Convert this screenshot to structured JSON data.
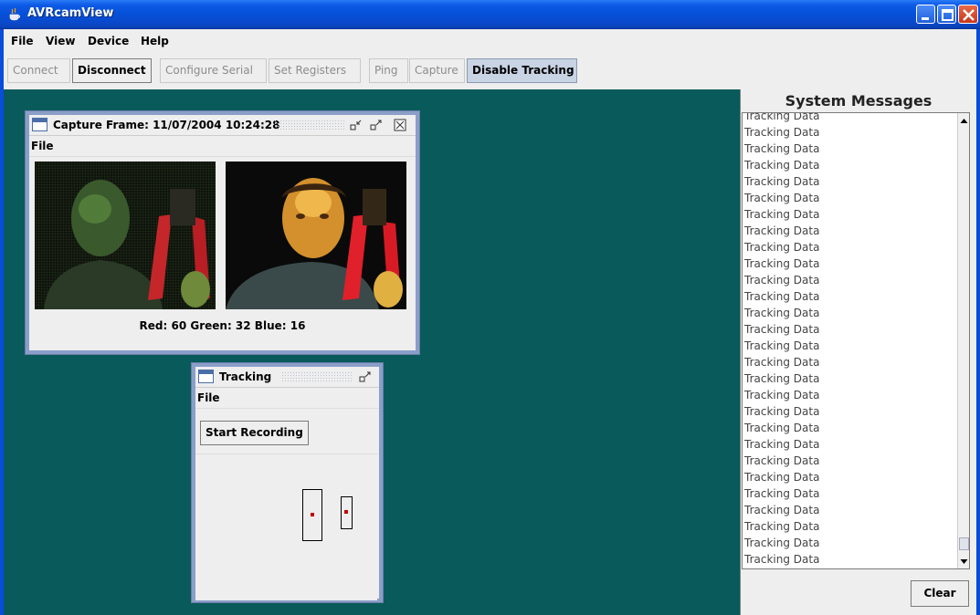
{
  "window": {
    "title": "AVRcamView",
    "icon": "java-cup-icon",
    "controls": [
      "minimize-icon",
      "maximize-icon",
      "close-icon"
    ]
  },
  "menubar": {
    "items": [
      {
        "label": "File",
        "mnemonic": "F"
      },
      {
        "label": "View",
        "mnemonic": "V"
      },
      {
        "label": "Device",
        "mnemonic": "D"
      },
      {
        "label": "Help",
        "mnemonic": "H"
      }
    ]
  },
  "toolbar": {
    "buttons": [
      {
        "label": "Connect",
        "state": "disabled"
      },
      {
        "label": "Disconnect",
        "state": "enabled"
      },
      {
        "label": "Configure Serial",
        "state": "disabled"
      },
      {
        "label": "Set Registers",
        "state": "disabled"
      },
      {
        "label": "Ping",
        "state": "disabled"
      },
      {
        "label": "Capture",
        "state": "disabled"
      },
      {
        "label": "Disable Tracking",
        "state": "active"
      }
    ]
  },
  "capture_frame": {
    "title": "Capture Frame: 11/07/2004 10:24:28",
    "menu_label": "File",
    "color_readout": "Red: 60 Green: 32 Blue: 16"
  },
  "tracking_frame": {
    "title": "Tracking",
    "menu_label": "File",
    "start_recording_label": "Start Recording",
    "start_recording_mnemonic": "S"
  },
  "system_messages": {
    "title": "System Messages",
    "lines": [
      "Tracking Data",
      "Tracking Data",
      "Tracking Data",
      "Tracking Data",
      "Tracking Data",
      "Tracking Data",
      "Tracking Data",
      "Tracking Data",
      "Tracking Data",
      "Tracking Data",
      "Tracking Data",
      "Tracking Data",
      "Tracking Data",
      "Tracking Data",
      "Tracking Data",
      "Tracking Data",
      "Tracking Data",
      "Tracking Data",
      "Tracking Data",
      "Tracking Data",
      "Tracking Data",
      "Tracking Data",
      "Tracking Data",
      "Tracking Data",
      "Tracking Data",
      "Tracking Data",
      "Tracking Data",
      "Tracking Data"
    ],
    "clear_label": "Clear"
  },
  "colors": {
    "desktop": "#095a5a",
    "titlebar": "#0650d8",
    "panel": "#eeeeee",
    "tracking_marker": "#c00000"
  }
}
